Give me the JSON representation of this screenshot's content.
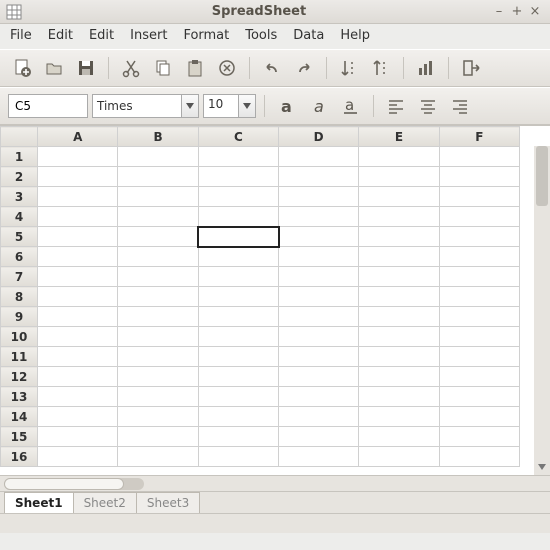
{
  "window": {
    "title": "SpreadSheet"
  },
  "menu": {
    "items": [
      "File",
      "Edit",
      "Edit",
      "Insert",
      "Format",
      "Tools",
      "Data",
      "Help"
    ]
  },
  "toolbar2": {
    "cellref": "C5",
    "font": "Times",
    "size": "10"
  },
  "grid": {
    "columns": [
      "A",
      "B",
      "C",
      "D",
      "E",
      "F"
    ],
    "rows": [
      "1",
      "2",
      "3",
      "4",
      "5",
      "6",
      "7",
      "8",
      "9",
      "10",
      "11",
      "12",
      "13",
      "14",
      "15",
      "16"
    ],
    "selected": "C5"
  },
  "tabs": {
    "items": [
      "Sheet1",
      "Sheet2",
      "Sheet3"
    ],
    "active": 0
  }
}
